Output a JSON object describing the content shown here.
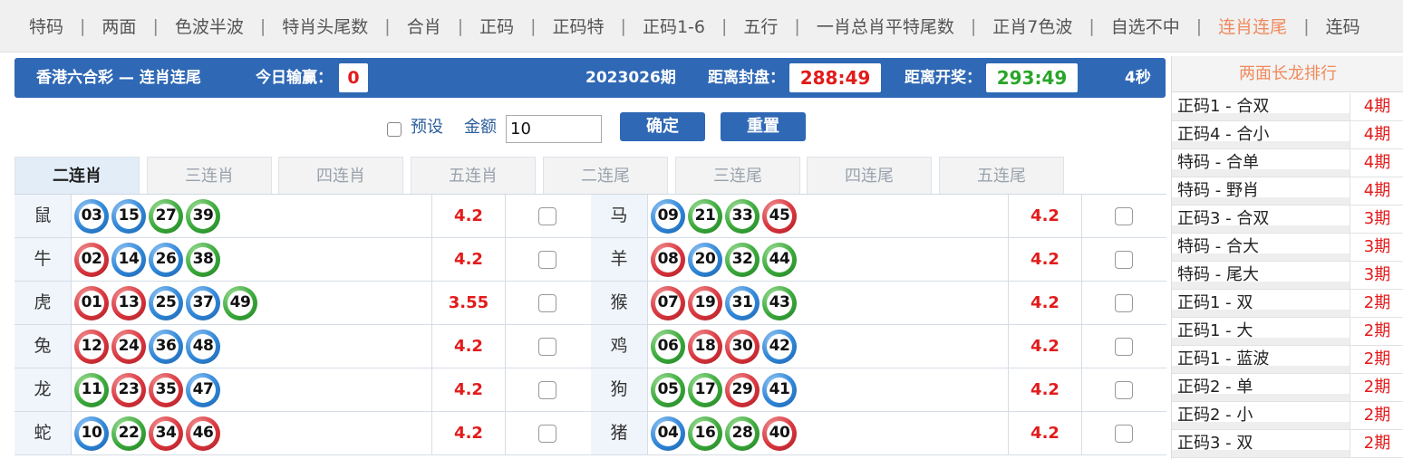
{
  "nav": {
    "items": [
      "特码",
      "两面",
      "色波半波",
      "特肖头尾数",
      "合肖",
      "正码",
      "正码特",
      "正码1-6",
      "五行",
      "一肖总肖平特尾数",
      "正肖7色波",
      "自选不中",
      "连肖连尾",
      "连码"
    ],
    "active_index": 12,
    "separator": "|"
  },
  "header": {
    "title": "香港六合彩 — 连肖连尾",
    "today_label": "今日输赢：",
    "today_value": "0",
    "period": "2023026期",
    "close_label": "距离封盘：",
    "close_time": "288:49",
    "draw_label": "距离开奖：",
    "draw_time": "293:49",
    "refresh": "4秒"
  },
  "controls": {
    "preset_label": "预设",
    "amount_label": "金额",
    "amount_value": "10",
    "confirm_label": "确定",
    "reset_label": "重置"
  },
  "tabs": [
    "二连肖",
    "三连肖",
    "四连肖",
    "五连肖",
    "二连尾",
    "三连尾",
    "四连尾",
    "五连尾"
  ],
  "active_tab": 0,
  "rows": [
    {
      "left": {
        "zodiac": "鼠",
        "balls": [
          [
            "03",
            "blue"
          ],
          [
            "15",
            "blue"
          ],
          [
            "27",
            "green"
          ],
          [
            "39",
            "green"
          ]
        ],
        "odds": "4.2"
      },
      "right": {
        "zodiac": "马",
        "balls": [
          [
            "09",
            "blue"
          ],
          [
            "21",
            "green"
          ],
          [
            "33",
            "green"
          ],
          [
            "45",
            "red"
          ]
        ],
        "odds": "4.2"
      }
    },
    {
      "left": {
        "zodiac": "牛",
        "balls": [
          [
            "02",
            "red"
          ],
          [
            "14",
            "blue"
          ],
          [
            "26",
            "blue"
          ],
          [
            "38",
            "green"
          ]
        ],
        "odds": "4.2"
      },
      "right": {
        "zodiac": "羊",
        "balls": [
          [
            "08",
            "red"
          ],
          [
            "20",
            "blue"
          ],
          [
            "32",
            "green"
          ],
          [
            "44",
            "green"
          ]
        ],
        "odds": "4.2"
      }
    },
    {
      "left": {
        "zodiac": "虎",
        "balls": [
          [
            "01",
            "red"
          ],
          [
            "13",
            "red"
          ],
          [
            "25",
            "blue"
          ],
          [
            "37",
            "blue"
          ],
          [
            "49",
            "green"
          ]
        ],
        "odds": "3.55"
      },
      "right": {
        "zodiac": "猴",
        "balls": [
          [
            "07",
            "red"
          ],
          [
            "19",
            "red"
          ],
          [
            "31",
            "blue"
          ],
          [
            "43",
            "green"
          ]
        ],
        "odds": "4.2"
      }
    },
    {
      "left": {
        "zodiac": "兔",
        "balls": [
          [
            "12",
            "red"
          ],
          [
            "24",
            "red"
          ],
          [
            "36",
            "blue"
          ],
          [
            "48",
            "blue"
          ]
        ],
        "odds": "4.2"
      },
      "right": {
        "zodiac": "鸡",
        "balls": [
          [
            "06",
            "green"
          ],
          [
            "18",
            "red"
          ],
          [
            "30",
            "red"
          ],
          [
            "42",
            "blue"
          ]
        ],
        "odds": "4.2"
      }
    },
    {
      "left": {
        "zodiac": "龙",
        "balls": [
          [
            "11",
            "green"
          ],
          [
            "23",
            "red"
          ],
          [
            "35",
            "red"
          ],
          [
            "47",
            "blue"
          ]
        ],
        "odds": "4.2"
      },
      "right": {
        "zodiac": "狗",
        "balls": [
          [
            "05",
            "green"
          ],
          [
            "17",
            "green"
          ],
          [
            "29",
            "red"
          ],
          [
            "41",
            "blue"
          ]
        ],
        "odds": "4.2"
      }
    },
    {
      "left": {
        "zodiac": "蛇",
        "balls": [
          [
            "10",
            "blue"
          ],
          [
            "22",
            "green"
          ],
          [
            "34",
            "red"
          ],
          [
            "46",
            "red"
          ]
        ],
        "odds": "4.2"
      },
      "right": {
        "zodiac": "猪",
        "balls": [
          [
            "04",
            "blue"
          ],
          [
            "16",
            "green"
          ],
          [
            "28",
            "green"
          ],
          [
            "40",
            "red"
          ]
        ],
        "odds": "4.2"
      }
    }
  ],
  "long_dragon": {
    "title": "两面长龙排行",
    "items": [
      {
        "name": "正码1 - 合双",
        "value": "4期"
      },
      {
        "name": "正码4 - 合小",
        "value": "4期"
      },
      {
        "name": "特码 - 合单",
        "value": "4期"
      },
      {
        "name": "特码 - 野肖",
        "value": "4期"
      },
      {
        "name": "正码3 - 合双",
        "value": "3期"
      },
      {
        "name": "特码 - 合大",
        "value": "3期"
      },
      {
        "name": "特码 - 尾大",
        "value": "3期"
      },
      {
        "name": "正码1 - 双",
        "value": "2期"
      },
      {
        "name": "正码1 - 大",
        "value": "2期"
      },
      {
        "name": "正码1 - 蓝波",
        "value": "2期"
      },
      {
        "name": "正码2 - 单",
        "value": "2期"
      },
      {
        "name": "正码2 - 小",
        "value": "2期"
      },
      {
        "name": "正码3 - 双",
        "value": "2期"
      }
    ]
  },
  "colors": {
    "accent": "#2f68b5",
    "active_nav": "#f08a5d",
    "odds": "#e21b1b",
    "draw_time": "#2aa52a"
  }
}
